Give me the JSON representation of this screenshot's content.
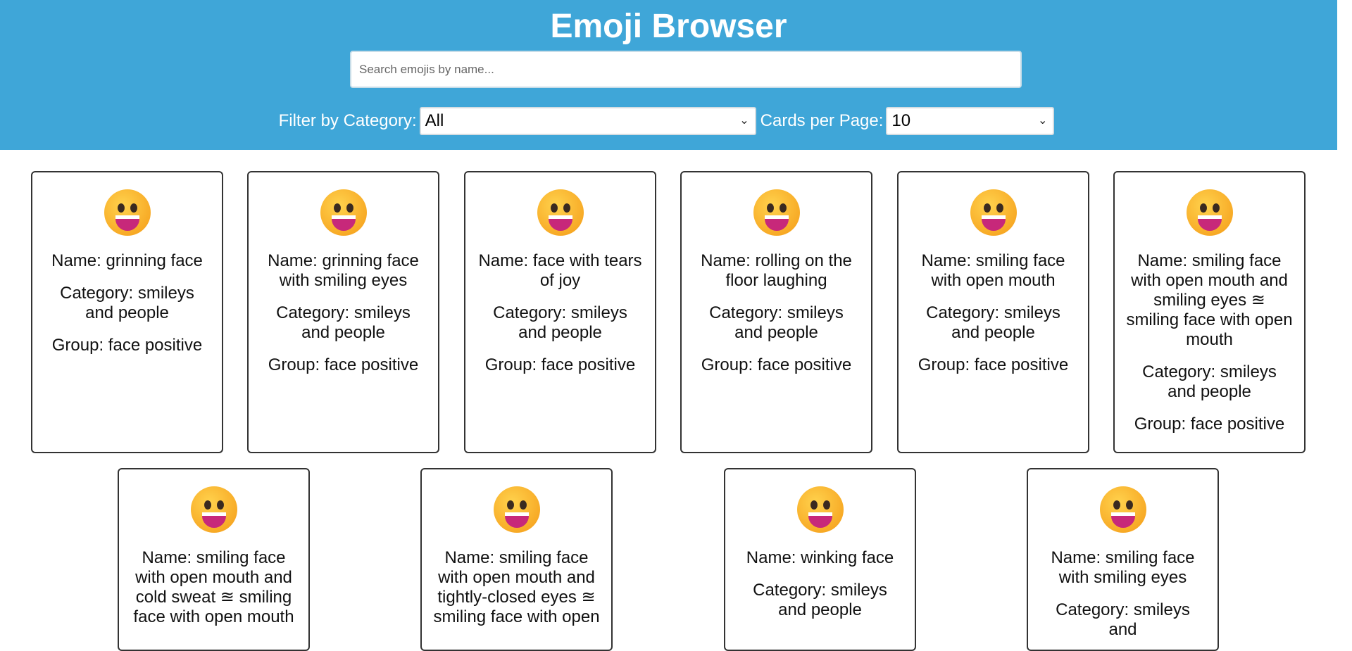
{
  "header": {
    "title": "Emoji Browser",
    "search_placeholder": "Search emojis by name...",
    "category_label": "Filter by Category:",
    "category_value": "All",
    "per_page_label": "Cards per Page:",
    "per_page_value": "10"
  },
  "colors": {
    "header_bg": "#3fa6d8",
    "card_border": "#333333"
  },
  "cards": [
    {
      "emoji_icon": "grinning-face-icon",
      "name": "Name: grinning face",
      "category": "Category: smileys and people",
      "group": "Group: face positive"
    },
    {
      "emoji_icon": "grinning-face-with-smiling-eyes-icon",
      "name": "Name: grinning face with smiling eyes",
      "category": "Category: smileys and people",
      "group": "Group: face positive"
    },
    {
      "emoji_icon": "face-with-tears-of-joy-icon",
      "name": "Name: face with tears of joy",
      "category": "Category: smileys and people",
      "group": "Group: face positive"
    },
    {
      "emoji_icon": "rolling-on-the-floor-laughing-icon",
      "name": "Name: rolling on the floor laughing",
      "category": "Category: smileys and people",
      "group": "Group: face positive"
    },
    {
      "emoji_icon": "smiling-face-with-open-mouth-icon",
      "name": "Name: smiling face with open mouth",
      "category": "Category: smileys and people",
      "group": "Group: face positive"
    },
    {
      "emoji_icon": "smiling-face-with-open-mouth-and-smiling-eyes-icon",
      "name": "Name: smiling face with open mouth and smiling eyes ≊ smiling face with open mouth",
      "category": "Category: smileys and people",
      "group": "Group: face positive"
    },
    {
      "emoji_icon": "smiling-face-with-open-mouth-and-cold-sweat-icon",
      "name": "Name: smiling face with open mouth and cold sweat ≊ smiling face with open mouth",
      "category": "",
      "group": ""
    },
    {
      "emoji_icon": "smiling-face-with-open-mouth-and-tightly-closed-eyes-icon",
      "name": "Name: smiling face with open mouth and tightly-closed eyes ≊ smiling face with open",
      "category": "",
      "group": ""
    },
    {
      "emoji_icon": "winking-face-icon",
      "name": "Name: winking face",
      "category": "Category: smileys and people",
      "group": ""
    },
    {
      "emoji_icon": "smiling-face-with-smiling-eyes-icon",
      "name": "Name: smiling face with smiling eyes",
      "category": "Category: smileys and",
      "group": ""
    }
  ]
}
